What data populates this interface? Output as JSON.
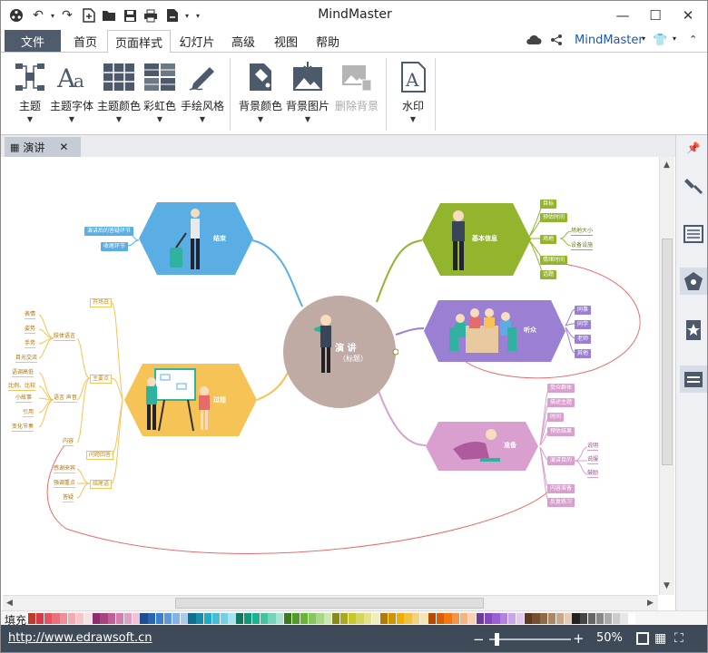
{
  "app": {
    "title": "MindMaster",
    "brand": "MindMaster",
    "quick_access_icons": [
      "logo-icon",
      "undo-icon",
      "redo-icon",
      "new-icon",
      "open-icon",
      "save-icon",
      "print-icon",
      "export-icon",
      "customize-icon"
    ]
  },
  "menu": {
    "file": "文件",
    "tabs": [
      {
        "label": "首页",
        "active": false
      },
      {
        "label": "页面样式",
        "active": true
      },
      {
        "label": "幻灯片",
        "active": false
      },
      {
        "label": "高级",
        "active": false
      },
      {
        "label": "视图",
        "active": false
      },
      {
        "label": "帮助",
        "active": false
      }
    ]
  },
  "ribbon": {
    "theme": "主题",
    "theme_font": "主题字体",
    "theme_color": "主题颜色",
    "rainbow": "彩虹色",
    "hand_drawn": "手绘风格",
    "bg_color": "背景颜色",
    "bg_image": "背景图片",
    "remove_bg": "删除背景",
    "watermark": "水印"
  },
  "document": {
    "tab_label": "演讲"
  },
  "mindmap": {
    "center": {
      "line1": "演    讲",
      "line2": "（标题）",
      "color": "#bfaaa4"
    },
    "topics": {
      "conclusion": {
        "label": "结束",
        "color": "#5aaee3"
      },
      "basic_info": {
        "label": "基本信息",
        "color": "#93b52d"
      },
      "audience": {
        "label": "听众",
        "color": "#9a7fd3"
      },
      "preparation": {
        "label": "准备",
        "color": "#d9a0cf"
      },
      "process": {
        "label": "过程",
        "color": "#f5c356"
      }
    },
    "conclusion_items": [
      "演讲后的答疑环节",
      "收尾环节"
    ],
    "basic_items": [
      "目标",
      "预估时间",
      "场地",
      "情绪时间",
      "话题"
    ],
    "venue_items": [
      "场地大小",
      "设备设施"
    ],
    "audience_items": [
      "同事",
      "同学",
      "老师",
      "其他"
    ],
    "prep_items": [
      "受众群体",
      "描述主题",
      "时间",
      "预估结果",
      "演讲目的",
      "内容准备",
      "反复练习"
    ],
    "purpose_items": [
      "说明",
      "说服",
      "鼓励"
    ],
    "process_items": [
      "开场白",
      "主要点",
      "问题回答",
      "结尾语"
    ],
    "language_label": "肢体语言",
    "language_items": [
      "表情",
      "姿势",
      "手势",
      "目光交流"
    ],
    "voice_label": "语言  声音",
    "voice_items": [
      "语调高低",
      "比例、比较",
      "小故事",
      "引用",
      "变化节奏"
    ],
    "content_label": "内容",
    "ending_items": [
      "感谢来宾",
      "强调重点",
      "答疑"
    ]
  },
  "palette": {
    "label": "填充",
    "colors": [
      "#c0392b",
      "#d63a4a",
      "#e0555f",
      "#e8707a",
      "#ef8e96",
      "#f4aab0",
      "#f8c6ca",
      "#fbe0e2",
      "#8e2c6d",
      "#a8447f",
      "#c06095",
      "#d27fab",
      "#e0a0c2",
      "#edc3d9",
      "#1d4e8f",
      "#2a66b0",
      "#3b7fce",
      "#5e98da",
      "#83b2e4",
      "#a9cbee",
      "#0f6e8e",
      "#178cad",
      "#1fa9cb",
      "#47bcd8",
      "#77cfe3",
      "#a8e2ee",
      "#0d7a5e",
      "#129877",
      "#1ab38d",
      "#44c3a2",
      "#74d3b9",
      "#a6e3d1",
      "#3b7a1f",
      "#4f9a29",
      "#66b634",
      "#86c75b",
      "#a8d885",
      "#c9e9b0",
      "#8a8a1a",
      "#a8a823",
      "#c6c62f",
      "#d5d55d",
      "#e2e28c",
      "#eeeebb",
      "#b57a00",
      "#d39300",
      "#eead05",
      "#f2c03f",
      "#f5d27a",
      "#f9e3b2",
      "#b84a00",
      "#d85f05",
      "#f27813",
      "#f49449",
      "#f7b27f",
      "#fad0b5",
      "#6d3b9c",
      "#8449ba",
      "#9b5fd1",
      "#b282dc",
      "#c9a6e7",
      "#e0caf2",
      "#5c3a21",
      "#75502e",
      "#8f6a45",
      "#aa8867",
      "#c5a98d",
      "#e0ccb8",
      "#222222",
      "#444444",
      "#666666",
      "#888888",
      "#aaaaaa",
      "#cccccc",
      "#e6e6e6",
      "#ffffff"
    ]
  },
  "status": {
    "url": "http://www.edrawsoft.cn",
    "zoom": "50%"
  }
}
